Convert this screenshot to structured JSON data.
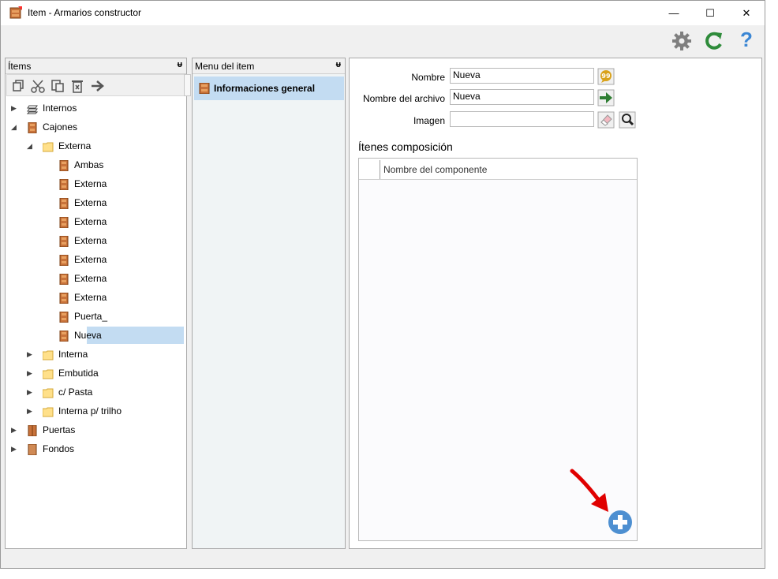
{
  "window": {
    "title": "Item - Armarios constructor",
    "minimize": "—",
    "maximize": "☐",
    "close": "✕"
  },
  "toolbar": {
    "settings_icon": "gear-icon",
    "refresh_icon": "refresh-icon",
    "help_label": "?"
  },
  "colors": {
    "gear": "#7f7f7f",
    "refresh": "#2e8b3a",
    "help": "#3a86d4",
    "selection": "#c3dcf2",
    "add_button": "#4d8fd1",
    "arrow_annotation": "#e00000"
  },
  "items_panel": {
    "title": "Ítems",
    "pin": "ᵾ",
    "tools": [
      "copy-icon",
      "cut-icon",
      "paste-icon",
      "delete-icon",
      "move-icon"
    ],
    "tree": [
      {
        "label": "Internos",
        "icon": "stack-icon",
        "level": 0,
        "arrow": "▶"
      },
      {
        "label": "Cajones",
        "icon": "cabinet-icon",
        "level": 0,
        "arrow": "◢"
      },
      {
        "label": "Externa",
        "icon": "folder-icon",
        "level": 1,
        "arrow": "◢"
      },
      {
        "label": "Ambas",
        "icon": "cabinet-icon",
        "level": 2,
        "arrow": ""
      },
      {
        "label": "Externa",
        "icon": "cabinet-icon",
        "level": 2,
        "arrow": ""
      },
      {
        "label": "Externa",
        "icon": "cabinet-icon",
        "level": 2,
        "arrow": ""
      },
      {
        "label": "Externa",
        "icon": "cabinet-icon",
        "level": 2,
        "arrow": ""
      },
      {
        "label": "Externa",
        "icon": "cabinet-icon",
        "level": 2,
        "arrow": ""
      },
      {
        "label": "Externa",
        "icon": "cabinet-icon",
        "level": 2,
        "arrow": ""
      },
      {
        "label": "Externa",
        "icon": "cabinet-icon",
        "level": 2,
        "arrow": ""
      },
      {
        "label": "Externa",
        "icon": "cabinet-icon",
        "level": 2,
        "arrow": ""
      },
      {
        "label": "Puerta_",
        "icon": "cabinet-icon",
        "level": 2,
        "arrow": ""
      },
      {
        "label": "Nueva",
        "icon": "cabinet-icon",
        "level": 2,
        "arrow": "",
        "selected": true
      },
      {
        "label": "Interna",
        "icon": "folder-icon",
        "level": 1,
        "arrow": "▶"
      },
      {
        "label": "Embutida",
        "icon": "folder-icon",
        "level": 1,
        "arrow": "▶"
      },
      {
        "label": "c/ Pasta",
        "icon": "folder-icon",
        "level": 1,
        "arrow": "▶"
      },
      {
        "label": "Interna p/ trilho",
        "icon": "folder-icon",
        "level": 1,
        "arrow": "▶"
      },
      {
        "label": "Puertas",
        "icon": "door-icon",
        "level": 0,
        "arrow": "▶"
      },
      {
        "label": "Fondos",
        "icon": "panel-icon",
        "level": 0,
        "arrow": "▶"
      }
    ]
  },
  "menu_panel": {
    "title": "Menu del item",
    "pin": "ᵾ",
    "items": [
      {
        "label": "Informaciones general",
        "icon": "cabinet-icon"
      }
    ]
  },
  "form": {
    "nombre_label": "Nombre",
    "nombre_value": "Nueva",
    "archivo_label": "Nombre del archivo",
    "archivo_value": "Nueva",
    "imagen_label": "Imagen",
    "imagen_value": "",
    "composicion_title": "Ítenes composición",
    "grid_column": "Nombre del componente"
  }
}
